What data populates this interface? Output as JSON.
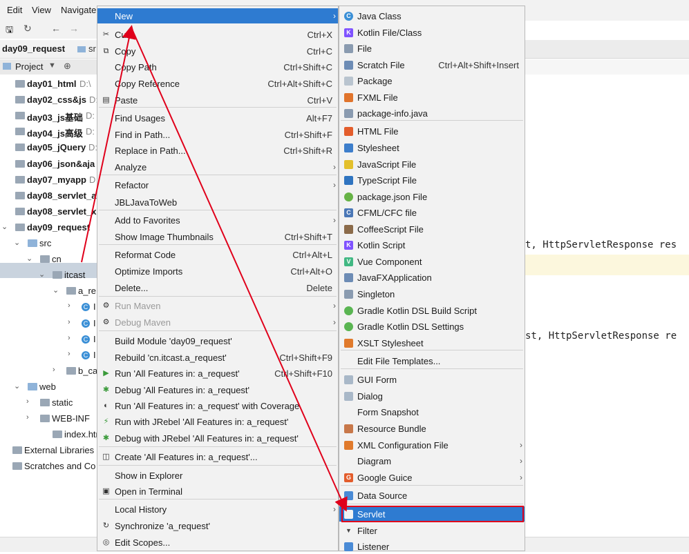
{
  "menubar": [
    "Edit",
    "View",
    "Navigate"
  ],
  "nav": {
    "project": "day09_request",
    "src_fragment": "sr"
  },
  "project_header": "Project",
  "tree": [
    {
      "label": "day01_html",
      "sub": "D:\\"
    },
    {
      "label": "day02_css&js",
      "sub": "D:"
    },
    {
      "label": "day03_js基础",
      "sub": "D:"
    },
    {
      "label": "day04_js高级",
      "sub": "D:"
    },
    {
      "label": "day05_jQuery",
      "sub": "D:"
    },
    {
      "label": "day06_json&aja",
      "sub": ""
    },
    {
      "label": "day07_myapp",
      "sub": "D"
    },
    {
      "label": "day08_servlet_a",
      "sub": ""
    },
    {
      "label": "day08_servlet_x",
      "sub": ""
    },
    {
      "label": "day09_request",
      "sub": ""
    },
    {
      "label": "src",
      "sub": ""
    },
    {
      "label": "cn",
      "sub": ""
    },
    {
      "label": "itcast",
      "sub": ""
    },
    {
      "label": "a_re",
      "sub": ""
    },
    {
      "label": "I",
      "sub": ""
    },
    {
      "label": "I",
      "sub": ""
    },
    {
      "label": "I",
      "sub": ""
    },
    {
      "label": "I",
      "sub": ""
    },
    {
      "label": "b_ca",
      "sub": ""
    },
    {
      "label": "web",
      "sub": ""
    },
    {
      "label": "static",
      "sub": ""
    },
    {
      "label": "WEB-INF",
      "sub": ""
    },
    {
      "label": "index.html",
      "sub": ""
    },
    {
      "label": "External Libraries",
      "sub": ""
    },
    {
      "label": "Scratches and Co",
      "sub": ""
    }
  ],
  "editor": {
    "line1": "t, HttpServletResponse res",
    "line2": "st, HttpServletResponse re"
  },
  "menu1": [
    {
      "label": "New",
      "shortcut": "",
      "submenu": true,
      "active": true,
      "icon": ""
    },
    {
      "label": "Cut",
      "shortcut": "Ctrl+X",
      "icon": "✂"
    },
    {
      "label": "Copy",
      "shortcut": "Ctrl+C",
      "icon": "⧉"
    },
    {
      "label": "Copy Path",
      "shortcut": "Ctrl+Shift+C"
    },
    {
      "label": "Copy Reference",
      "shortcut": "Ctrl+Alt+Shift+C"
    },
    {
      "label": "Paste",
      "shortcut": "Ctrl+V",
      "icon": "▤"
    },
    {
      "label": "Find Usages",
      "shortcut": "Alt+F7"
    },
    {
      "label": "Find in Path...",
      "shortcut": "Ctrl+Shift+F"
    },
    {
      "label": "Replace in Path...",
      "shortcut": "Ctrl+Shift+R"
    },
    {
      "label": "Analyze",
      "submenu": true
    },
    {
      "label": "Refactor",
      "submenu": true
    },
    {
      "label": "JBLJavaToWeb"
    },
    {
      "label": "Add to Favorites",
      "submenu": true
    },
    {
      "label": "Show Image Thumbnails",
      "shortcut": "Ctrl+Shift+T"
    },
    {
      "label": "Reformat Code",
      "shortcut": "Ctrl+Alt+L"
    },
    {
      "label": "Optimize Imports",
      "shortcut": "Ctrl+Alt+O"
    },
    {
      "label": "Delete...",
      "shortcut": "Delete"
    },
    {
      "label": "Run Maven",
      "submenu": true,
      "disabled": true,
      "icon": "⚙"
    },
    {
      "label": "Debug Maven",
      "submenu": true,
      "disabled": true,
      "icon": "⚙"
    },
    {
      "label": "Build Module 'day09_request'"
    },
    {
      "label": "Rebuild 'cn.itcast.a_request'",
      "shortcut": "Ctrl+Shift+F9"
    },
    {
      "label": "Run 'All Features in: a_request'",
      "shortcut": "Ctrl+Shift+F10",
      "icon": "▶"
    },
    {
      "label": "Debug 'All Features in: a_request'",
      "icon": "✱"
    },
    {
      "label": "Run 'All Features in: a_request' with Coverage",
      "icon": "◐"
    },
    {
      "label": "Run with JRebel 'All Features in: a_request'",
      "icon": "⚡"
    },
    {
      "label": "Debug with JRebel 'All Features in: a_request'",
      "icon": "✱"
    },
    {
      "label": "Create 'All Features in: a_request'...",
      "icon": "◫"
    },
    {
      "label": "Show in Explorer"
    },
    {
      "label": "Open in Terminal",
      "icon": "▣"
    },
    {
      "label": "Local History",
      "submenu": true
    },
    {
      "label": "Synchronize 'a_request'",
      "icon": "↻"
    },
    {
      "label": "Edit Scopes...",
      "icon": "◎"
    }
  ],
  "menu2": [
    {
      "label": "Java Class",
      "icon_color": "#3a8fd6",
      "round": true,
      "glyph": "C"
    },
    {
      "label": "Kotlin File/Class",
      "icon_color": "#7f52ff",
      "glyph": "K"
    },
    {
      "label": "File",
      "icon_color": "#8a9bb0",
      "glyph": ""
    },
    {
      "label": "Scratch File",
      "shortcut": "Ctrl+Alt+Shift+Insert",
      "icon_color": "#6d8cb5",
      "glyph": ""
    },
    {
      "label": "Package",
      "icon_color": "#b9c4cf",
      "glyph": ""
    },
    {
      "label": "FXML File",
      "icon_color": "#e0742c",
      "glyph": ""
    },
    {
      "label": "package-info.java",
      "icon_color": "#8a9bb0",
      "glyph": ""
    },
    {
      "label": "HTML File",
      "icon_color": "#e35d2c",
      "glyph": ""
    },
    {
      "label": "Stylesheet",
      "icon_color": "#3d7ecb",
      "glyph": ""
    },
    {
      "label": "JavaScript File",
      "icon_color": "#e3c02c",
      "glyph": ""
    },
    {
      "label": "TypeScript File",
      "icon_color": "#2f74c0",
      "glyph": ""
    },
    {
      "label": "package.json File",
      "icon_color": "#67b346",
      "round": true,
      "glyph": ""
    },
    {
      "label": "CFML/CFC file",
      "icon_color": "#4a77b6",
      "glyph": "C"
    },
    {
      "label": "CoffeeScript File",
      "icon_color": "#8b6b4a",
      "glyph": ""
    },
    {
      "label": "Kotlin Script",
      "icon_color": "#7f52ff",
      "glyph": "K"
    },
    {
      "label": "Vue Component",
      "icon_color": "#41b883",
      "glyph": "V"
    },
    {
      "label": "JavaFXApplication",
      "icon_color": "#6d8cb5",
      "glyph": ""
    },
    {
      "label": "Singleton",
      "icon_color": "#8a9bb0",
      "glyph": ""
    },
    {
      "label": "Gradle Kotlin DSL Build Script",
      "icon_color": "#5ab552",
      "round": true,
      "glyph": ""
    },
    {
      "label": "Gradle Kotlin DSL Settings",
      "icon_color": "#5ab552",
      "round": true,
      "glyph": ""
    },
    {
      "label": "XSLT Stylesheet",
      "icon_color": "#e07a2c",
      "glyph": ""
    },
    {
      "label": "Edit File Templates...",
      "noicon": true
    },
    {
      "label": "GUI Form",
      "icon_color": "#a9b8c8",
      "glyph": ""
    },
    {
      "label": "Dialog",
      "icon_color": "#a9b8c8",
      "glyph": ""
    },
    {
      "label": "Form Snapshot",
      "noicon": true
    },
    {
      "label": "Resource Bundle",
      "icon_color": "#c8784a",
      "glyph": ""
    },
    {
      "label": "XML Configuration File",
      "icon_color": "#e07a2c",
      "glyph": "",
      "submenu": true
    },
    {
      "label": "Diagram",
      "noicon": true,
      "submenu": true
    },
    {
      "label": "Google Guice",
      "icon_color": "#e35d2c",
      "glyph": "G",
      "submenu": true
    },
    {
      "label": "Data Source",
      "icon_color": "#4a8bd6",
      "glyph": ""
    },
    {
      "label": "Servlet",
      "icon_color": "#f2f2f2",
      "glyph": "",
      "active": true,
      "highlighted": true
    },
    {
      "label": "Filter",
      "icon_color": "#555555",
      "glyph": "▼"
    },
    {
      "label": "Listener",
      "icon_color": "#4a8bd6",
      "glyph": ""
    }
  ],
  "colors": {
    "selection": "#2e7bd1",
    "annotation": "#e0001b"
  }
}
